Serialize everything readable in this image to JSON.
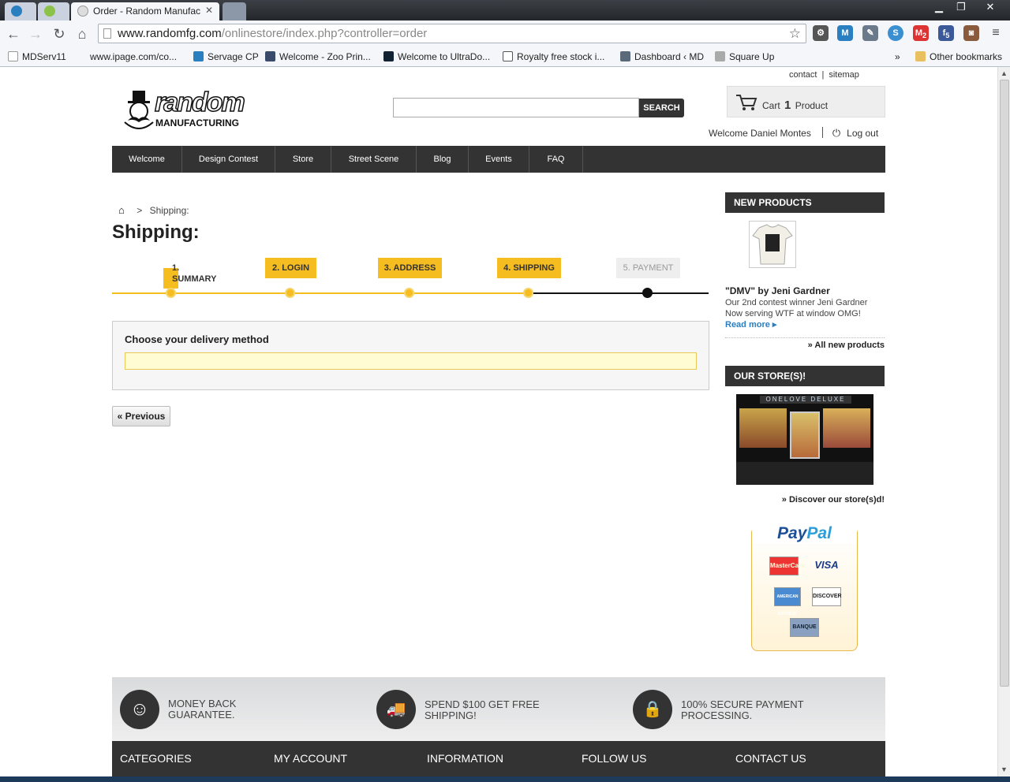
{
  "browser": {
    "tabs": [
      {
        "title": ""
      },
      {
        "title": ""
      },
      {
        "title": "Order - Random Manufac"
      },
      {
        "title": ""
      }
    ],
    "url_host": "www.randomfg.com",
    "url_path": "/onlinestore/index.php?controller=order",
    "bookmarks": [
      "MDServ11",
      "www.ipage.com/co...",
      "Servage CP",
      "Welcome - Zoo Prin...",
      "Welcome to UltraDo...",
      "Royalty free stock i...",
      "Dashboard ‹ MD",
      "Square Up"
    ],
    "bookmarks_more": "»",
    "other_bookmarks": "Other bookmarks",
    "ext_badges": {
      "gmail": "2",
      "facebook": "5"
    }
  },
  "site": {
    "top_links": {
      "contact": "contact",
      "sitemap": "sitemap",
      "sep": "|"
    },
    "logo_top": "random",
    "logo_bottom": "MANUFACTURING",
    "search": {
      "placeholder": "",
      "button": "SEARCH"
    },
    "cart": {
      "label": "Cart",
      "count": "1",
      "unit": "Product"
    },
    "welcome": "Welcome Daniel Montes",
    "logout": "Log out",
    "nav": [
      "Welcome",
      "Design Contest",
      "Store",
      "Street Scene",
      "Blog",
      "Events",
      "FAQ"
    ]
  },
  "main": {
    "breadcrumb_sep": ">",
    "breadcrumb_current": "Shipping:",
    "title": "Shipping:",
    "steps": [
      {
        "label": "1.\nSUMMARY",
        "state": "done"
      },
      {
        "label": "2. LOGIN",
        "state": "done"
      },
      {
        "label": "3. ADDRESS",
        "state": "done"
      },
      {
        "label": "4. SHIPPING",
        "state": "current"
      },
      {
        "label": "5. PAYMENT",
        "state": "todo"
      }
    ],
    "delivery_heading": "Choose your delivery method",
    "previous": "« Previous"
  },
  "sidebar": {
    "new_products_heading": "NEW PRODUCTS",
    "product_name": "\"DMV\" by Jeni Gardner",
    "product_desc": "Our 2nd contest winner Jeni Gardner Now serving WTF at window OMG!",
    "read_more": "Read more",
    "all_new": "» All new products",
    "stores_heading": "OUR STORE(S)!",
    "store_sign": "ONELOVE DELUXE",
    "discover": "» Discover our store(s)d!",
    "paypal": {
      "pay": "Pay",
      "pal": "Pal",
      "cards": [
        "MasterCard",
        "VISA",
        "AMERICAN EXPRESS",
        "DISCOVER",
        "BANQUE"
      ]
    }
  },
  "footer": {
    "features": [
      "MONEY BACK GUARANTEE.",
      "SPEND $100 GET FREE SHIPPING!",
      "100% SECURE PAYMENT PROCESSING."
    ],
    "columns": [
      "CATEGORIES",
      "MY ACCOUNT",
      "INFORMATION",
      "FOLLOW US",
      "CONTACT US"
    ]
  },
  "colors": {
    "accent": "#f5bd1f",
    "nav_bg": "#333333",
    "link": "#2a7fc0",
    "delivery_box": "#fffbd3"
  }
}
